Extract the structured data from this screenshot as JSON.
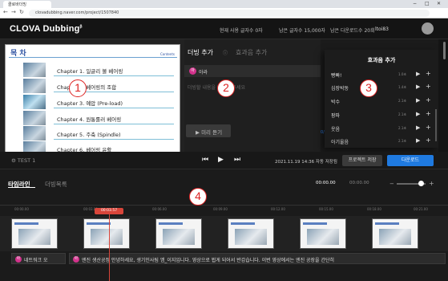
{
  "browser": {
    "tab_title": "클로바더빙",
    "url": "clovadubbing.naver.com/project/1507840",
    "win_min": "−",
    "win_max": "□",
    "win_close": "✕"
  },
  "header": {
    "logo": "CLOVA Dubbing",
    "logo_sup": "β",
    "usage_chars": "현재 사용 글자수 0자",
    "remain_chars": "남은 글자수 15,000자",
    "remain_downloads": "남은 다운로드수 20회",
    "user": "ltoi83"
  },
  "slide": {
    "title": "목 차",
    "tag": "Contents",
    "chapters": [
      "Chapter 1. 일글리 볼 베어링",
      "Chapter 2. 베어링의 조합",
      "Chapter 3. 예압 (Pre-load)",
      "Chapter 4. 원통롤러 베어링",
      "Chapter 5. 주축 (Spindle)",
      "Chapter 6. 베어링 윤활"
    ]
  },
  "dubbing": {
    "tab_add": "더빙 추가",
    "tab_sfx": "효과음 추가",
    "voice": "아라",
    "voice_badge": "아",
    "placeholder": "더빙할 내용을 입력해 주세요",
    "preview": "▶ 미리 듣기",
    "counter": "0/0"
  },
  "sfx": {
    "title": "효과음 추가",
    "items": [
      {
        "name": "빵빠!",
        "dur": "1.0초"
      },
      {
        "name": "심장박동",
        "dur": "1.4초"
      },
      {
        "name": "박수",
        "dur": "2.1초"
      },
      {
        "name": "팡파",
        "dur": "2.1초"
      },
      {
        "name": "웃음",
        "dur": "2.1초"
      },
      {
        "name": "아기울음",
        "dur": "2.1초"
      }
    ]
  },
  "player": {
    "project": "TEST 1",
    "saved": "2021.11.19 14:36 자동 저장됨",
    "save_project": "프로젝트 저장",
    "download": "다운로드"
  },
  "timeline": {
    "tab_timeline": "타임라인",
    "tab_list": "더빙목록",
    "time_current": "00:00.00",
    "time_total": "00:00.00",
    "playhead": "00:03.57",
    "ruler": [
      "00:00.00",
      "00:03.00",
      "00:06.00",
      "00:09.00",
      "00:12.00",
      "00:15.00",
      "00:18.00",
      "00:21.00"
    ],
    "captions": [
      {
        "badge": "아",
        "text": "네트워크 오"
      },
      {
        "badge": "아",
        "text": "엔진 생산공정 안녕하세요, 생기인사팀 엠_이지입니다. 영상으로 뵙게 되어서 반갑습니다. 이번 영상에서는 엔진 공장을 간단히"
      }
    ]
  },
  "annotations": [
    "1",
    "2",
    "3",
    "4"
  ]
}
